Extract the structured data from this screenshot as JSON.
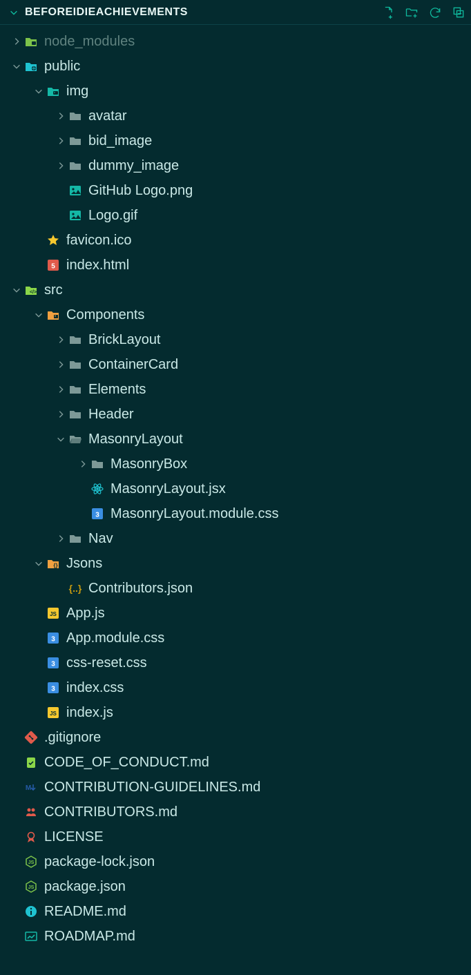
{
  "header": {
    "title": "BEFOREIDIEACHIEVEMENTS"
  },
  "tree": [
    {
      "depth": 0,
      "twisty": "right",
      "icon": "folder-nm",
      "label": "node_modules",
      "muted": true
    },
    {
      "depth": 0,
      "twisty": "down",
      "icon": "folder-public",
      "label": "public"
    },
    {
      "depth": 1,
      "twisty": "down",
      "icon": "folder-img",
      "label": "img"
    },
    {
      "depth": 2,
      "twisty": "right",
      "icon": "folder",
      "label": "avatar"
    },
    {
      "depth": 2,
      "twisty": "right",
      "icon": "folder",
      "label": "bid_image"
    },
    {
      "depth": 2,
      "twisty": "right",
      "icon": "folder",
      "label": "dummy_image"
    },
    {
      "depth": 2,
      "twisty": "none",
      "icon": "image",
      "label": "GitHub Logo.png"
    },
    {
      "depth": 2,
      "twisty": "none",
      "icon": "image",
      "label": "Logo.gif"
    },
    {
      "depth": 1,
      "twisty": "none",
      "icon": "star",
      "label": "favicon.ico"
    },
    {
      "depth": 1,
      "twisty": "none",
      "icon": "html",
      "label": "index.html"
    },
    {
      "depth": 0,
      "twisty": "down",
      "icon": "folder-src",
      "label": "src"
    },
    {
      "depth": 1,
      "twisty": "down",
      "icon": "folder-comp",
      "label": "Components"
    },
    {
      "depth": 2,
      "twisty": "right",
      "icon": "folder",
      "label": "BrickLayout"
    },
    {
      "depth": 2,
      "twisty": "right",
      "icon": "folder",
      "label": "ContainerCard"
    },
    {
      "depth": 2,
      "twisty": "right",
      "icon": "folder",
      "label": "Elements"
    },
    {
      "depth": 2,
      "twisty": "right",
      "icon": "folder",
      "label": "Header"
    },
    {
      "depth": 2,
      "twisty": "down",
      "icon": "folder-open",
      "label": "MasonryLayout"
    },
    {
      "depth": 3,
      "twisty": "right",
      "icon": "folder",
      "label": "MasonryBox"
    },
    {
      "depth": 3,
      "twisty": "none",
      "icon": "react",
      "label": "MasonryLayout.jsx"
    },
    {
      "depth": 3,
      "twisty": "none",
      "icon": "css",
      "label": "MasonryLayout.module.css"
    },
    {
      "depth": 2,
      "twisty": "right",
      "icon": "folder",
      "label": "Nav"
    },
    {
      "depth": 1,
      "twisty": "down",
      "icon": "folder-json",
      "label": "Jsons"
    },
    {
      "depth": 2,
      "twisty": "none",
      "icon": "json-file",
      "label": "Contributors.json"
    },
    {
      "depth": 1,
      "twisty": "none",
      "icon": "js",
      "label": "App.js"
    },
    {
      "depth": 1,
      "twisty": "none",
      "icon": "css",
      "label": "App.module.css"
    },
    {
      "depth": 1,
      "twisty": "none",
      "icon": "css",
      "label": "css-reset.css"
    },
    {
      "depth": 1,
      "twisty": "none",
      "icon": "css",
      "label": "index.css"
    },
    {
      "depth": 1,
      "twisty": "none",
      "icon": "js",
      "label": "index.js"
    },
    {
      "depth": 0,
      "twisty": "none",
      "icon": "git",
      "label": ".gitignore"
    },
    {
      "depth": 0,
      "twisty": "none",
      "icon": "conduct",
      "label": "CODE_OF_CONDUCT.md"
    },
    {
      "depth": 0,
      "twisty": "none",
      "icon": "md-arrow",
      "label": "CONTRIBUTION-GUIDELINES.md"
    },
    {
      "depth": 0,
      "twisty": "none",
      "icon": "people",
      "label": "CONTRIBUTORS.md"
    },
    {
      "depth": 0,
      "twisty": "none",
      "icon": "license",
      "label": "LICENSE"
    },
    {
      "depth": 0,
      "twisty": "none",
      "icon": "node",
      "label": "package-lock.json"
    },
    {
      "depth": 0,
      "twisty": "none",
      "icon": "node",
      "label": "package.json"
    },
    {
      "depth": 0,
      "twisty": "none",
      "icon": "info",
      "label": "README.md"
    },
    {
      "depth": 0,
      "twisty": "none",
      "icon": "roadmap",
      "label": "ROADMAP.md"
    }
  ]
}
